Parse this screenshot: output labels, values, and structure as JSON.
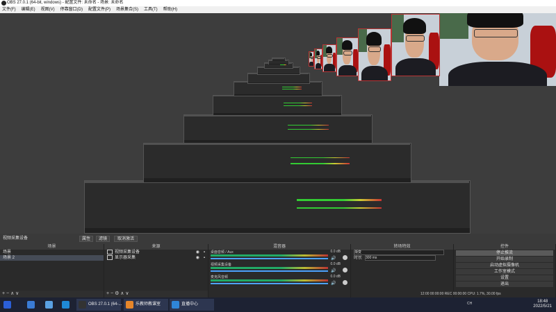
{
  "window": {
    "title": "OBS 27.0.1 (64-bit, windows) - 配置文件: 未命名 - 场景: 未命名"
  },
  "menu": [
    "文件(F)",
    "编辑(E)",
    "视图(V)",
    "停靠窗口(D)",
    "配置文件(P)",
    "场景集合(S)",
    "工具(T)",
    "帮助(H)"
  ],
  "controls_bar": {
    "title": "视频采集设备",
    "properties": "属性",
    "filters": "滤镜",
    "deactivate": "取消激活"
  },
  "scenes": {
    "header": "场景",
    "items": [
      "场景",
      "场景 2"
    ],
    "selected": 1,
    "toolbar": "+ − ∧ ∨"
  },
  "sources": {
    "header": "来源",
    "items": [
      {
        "name": "视频采集设备",
        "icon": "camera-icon"
      },
      {
        "name": "显示器采集",
        "icon": "monitor-icon"
      }
    ],
    "toolbar": "+ − ⚙ ∧ ∨"
  },
  "mixer": {
    "header": "混音器",
    "channels": [
      {
        "label": "桌面音频 / Aux",
        "db": "0.0 dB"
      },
      {
        "label": "视频采集设备",
        "db": "0.0 dB"
      },
      {
        "label": "麦克风音频",
        "db": "0.0 dB"
      }
    ]
  },
  "transitions": {
    "header": "转场特效",
    "type": "渐变",
    "duration_label": "时长",
    "duration": "300 ms"
  },
  "controls": {
    "header": "控件",
    "buttons": [
      "停止推流",
      "开始录制",
      "启动虚拟摄像机",
      "工作室模式",
      "设置",
      "退出"
    ],
    "active": 0
  },
  "status": {
    "fps_info": "12:00  00:00:00   REC 00:00:00   CPU: 1.7%, 30.00 fps"
  },
  "taskbar": {
    "apps": [
      {
        "label": "",
        "color": "#2b5fd9",
        "icon": "windows-start-icon"
      },
      {
        "label": "",
        "color": "#3a7bd5",
        "icon": "app-k-icon"
      },
      {
        "label": "",
        "color": "#5aa1e3",
        "icon": "app-wing-icon"
      },
      {
        "label": "",
        "color": "#1f8ad6",
        "icon": "edge-icon"
      },
      {
        "label": "OBS 27.0.1 (64-...",
        "color": "#333333",
        "icon": "obs-icon"
      },
      {
        "label": "乐教师教课室",
        "color": "#e6862a",
        "icon": "teacher-app-icon"
      },
      {
        "label": "直播中心",
        "color": "#2f86d8",
        "icon": "live-center-icon"
      }
    ],
    "tray_text": "CH",
    "time": "18:48",
    "date": "2022/5/21"
  }
}
